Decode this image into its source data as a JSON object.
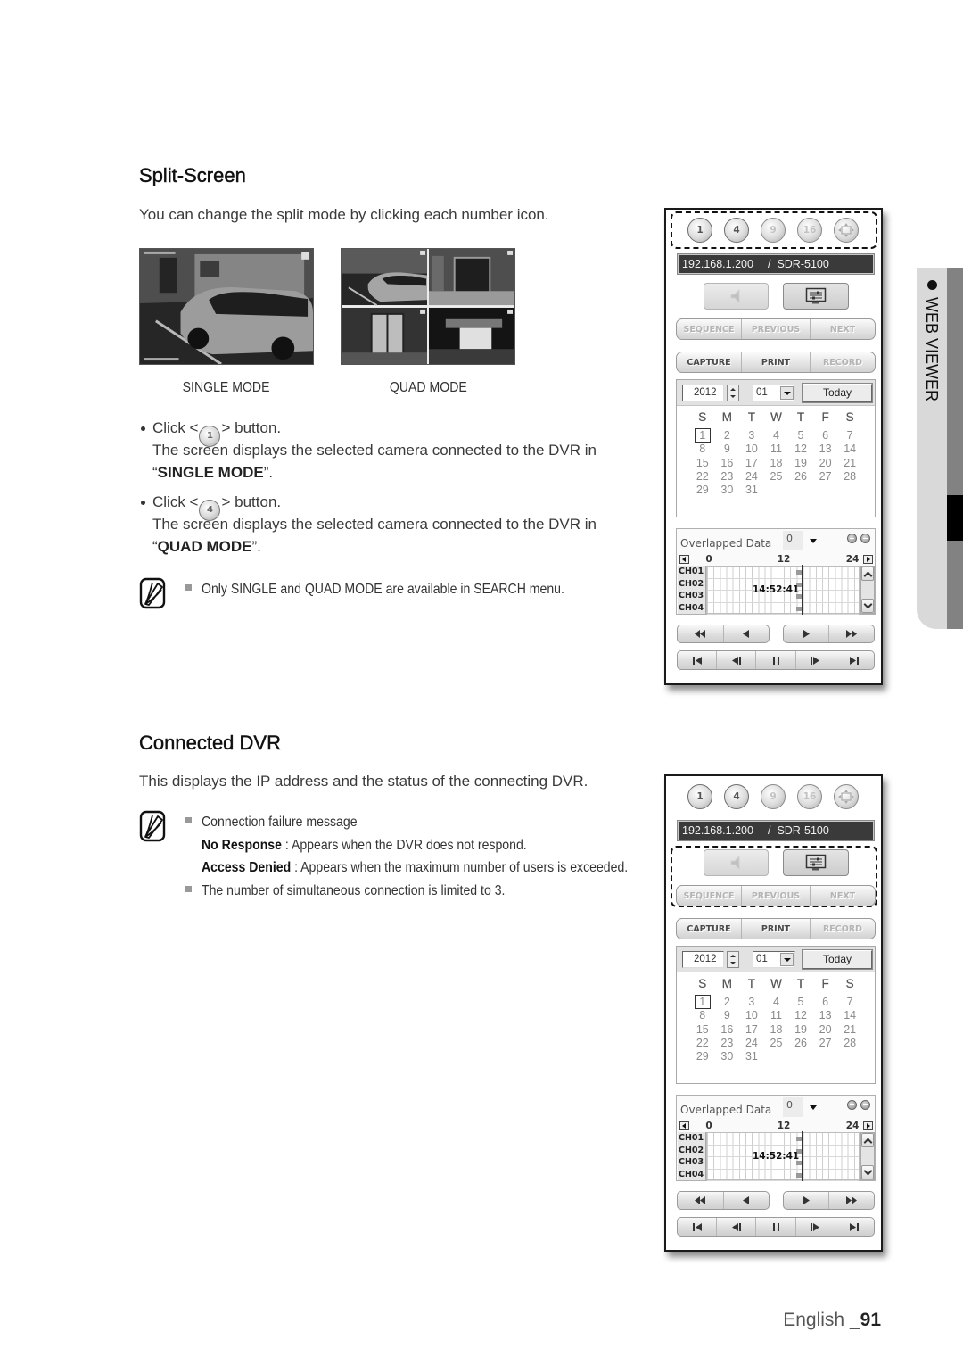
{
  "split_screen": {
    "title": "Split-Screen",
    "intro": "You can change the split mode by clicking each number icon.",
    "figures": [
      {
        "caption": "SINGLE MODE"
      },
      {
        "caption": "QUAD MODE"
      }
    ],
    "steps": [
      {
        "prefix": "Click <",
        "button": "1",
        "suffix": "> button.",
        "description": "The screen displays the selected camera connected to the DVR in",
        "mode_open": "“",
        "mode": "SINGLE MODE",
        "mode_close": "”."
      },
      {
        "prefix": "Click <",
        "button": "4",
        "suffix": "> button.",
        "description": "The screen displays the selected camera connected to the DVR in",
        "mode_open": "“",
        "mode": "QUAD MODE",
        "mode_close": "”."
      }
    ],
    "note": "Only SINGLE and QUAD MODE are available in SEARCH menu."
  },
  "connected_dvr": {
    "title": "Connected DVR",
    "intro": "This displays the IP address and the status of the connecting DVR.",
    "notes": {
      "heading": "Connection failure message",
      "messages": [
        {
          "term": "No Response",
          "text": " : Appears when the DVR does not respond."
        },
        {
          "term": "Access Denied",
          "text": " : Appears when the maximum number of users is exceeded."
        }
      ],
      "limit": "The number of simultaneous connection is limited to 3."
    }
  },
  "side_tab": {
    "label": "WEB VIEWER"
  },
  "page": {
    "language": "English",
    "separator": " _",
    "number": "91"
  },
  "panels": [
    {
      "highlight": "split-mode-buttons"
    },
    {
      "highlight": "audio-setup-and-sequence"
    }
  ],
  "viewer": {
    "split_buttons": [
      {
        "label": "1",
        "enabled": true
      },
      {
        "label": "4",
        "enabled": true
      },
      {
        "label": "9",
        "enabled": false
      },
      {
        "label": "16",
        "enabled": false
      }
    ],
    "fullscreen_enabled": false,
    "connection": {
      "ip": "192.168.1.200",
      "separator": "/",
      "model": "SDR-5100"
    },
    "audio_enabled": false,
    "nav_buttons": [
      {
        "label": "SEQUENCE",
        "enabled": false
      },
      {
        "label": "PREVIOUS",
        "enabled": false
      },
      {
        "label": "NEXT",
        "enabled": false
      }
    ],
    "action_buttons": [
      {
        "label": "CAPTURE",
        "enabled": true
      },
      {
        "label": "PRINT",
        "enabled": true
      },
      {
        "label": "RECORD",
        "enabled": false
      }
    ],
    "calendar": {
      "year": "2012",
      "month": "01",
      "today_label": "Today",
      "weekdays": [
        "S",
        "M",
        "T",
        "W",
        "T",
        "F",
        "S"
      ],
      "weeks": [
        [
          "1",
          "2",
          "3",
          "4",
          "5",
          "6",
          "7"
        ],
        [
          "8",
          "9",
          "10",
          "11",
          "12",
          "13",
          "14"
        ],
        [
          "15",
          "16",
          "17",
          "18",
          "19",
          "20",
          "21"
        ],
        [
          "22",
          "23",
          "24",
          "25",
          "26",
          "27",
          "28"
        ],
        [
          "29",
          "30",
          "31"
        ]
      ],
      "selected_day": "1"
    },
    "timeline": {
      "title": "Overlapped Data",
      "overlap_value": "0",
      "scale": [
        "0",
        "12",
        "24"
      ],
      "range_hours": [
        0,
        24
      ],
      "channels": [
        "CH01",
        "CH02",
        "CH03",
        "CH04"
      ],
      "current_time": "14:52:41"
    },
    "icons": {
      "split_fullscreen": "fullscreen-icon",
      "audio": "speaker-icon",
      "setup": "monitor-settings-icon",
      "playback_row1": [
        "fast-rewind-icon",
        "reverse-play-icon",
        "play-icon",
        "fast-forward-icon"
      ],
      "playback_row2": [
        "skip-to-start-icon",
        "step-back-icon",
        "pause-icon",
        "step-forward-icon",
        "skip-to-end-icon"
      ]
    }
  }
}
